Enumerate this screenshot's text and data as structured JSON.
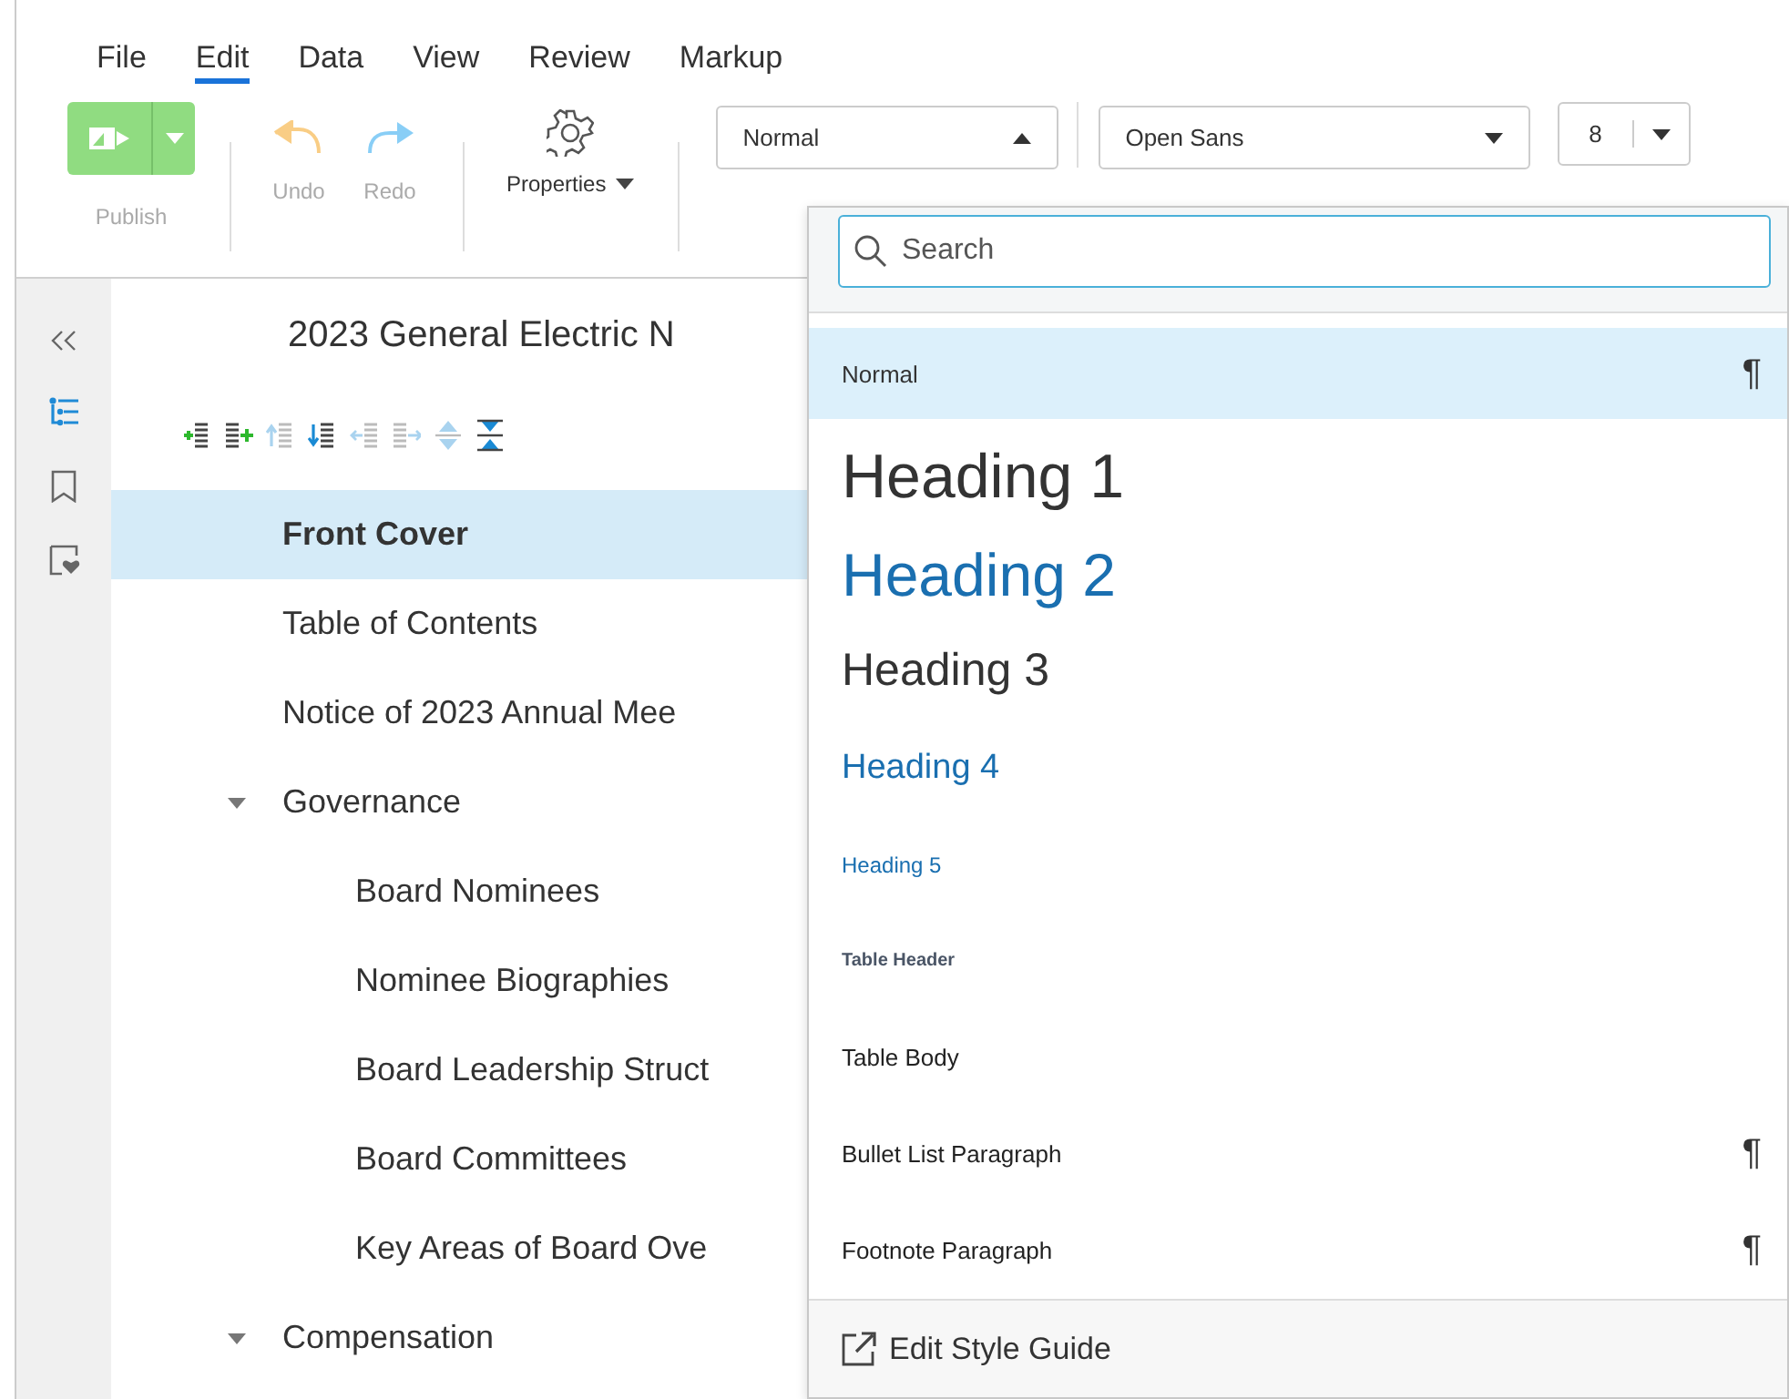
{
  "menu": [
    {
      "label": "File",
      "selected": false
    },
    {
      "label": "Edit",
      "selected": true
    },
    {
      "label": "Data",
      "selected": false
    },
    {
      "label": "View",
      "selected": false
    },
    {
      "label": "Review",
      "selected": false
    },
    {
      "label": "Markup",
      "selected": false
    }
  ],
  "toolbar": {
    "publish": {
      "label": "Publish",
      "disabled": true
    },
    "undo": {
      "label": "Undo",
      "disabled": true
    },
    "redo": {
      "label": "Redo",
      "disabled": true
    },
    "properties": {
      "label": "Properties"
    },
    "style_select": {
      "value": "Normal",
      "expanded": true
    },
    "font_select": {
      "value": "Open Sans",
      "expanded": false
    },
    "size_select": {
      "value": "8",
      "expanded": false
    }
  },
  "rail": [
    {
      "kind": "collapse",
      "selected": false
    },
    {
      "kind": "outline",
      "selected": true
    },
    {
      "kind": "bookmark",
      "selected": false
    },
    {
      "kind": "comment",
      "selected": false
    }
  ],
  "outline": {
    "title": "2023 General Electric N",
    "tools": [
      {
        "kind": "add-before",
        "disabled": false
      },
      {
        "kind": "add-after",
        "disabled": false
      },
      {
        "kind": "move-up",
        "disabled": true
      },
      {
        "kind": "move-down",
        "disabled": false
      },
      {
        "kind": "outdent",
        "disabled": true
      },
      {
        "kind": "indent",
        "disabled": true
      },
      {
        "kind": "expand-all",
        "disabled": true
      },
      {
        "kind": "collapse-all",
        "disabled": false
      }
    ],
    "items": [
      {
        "label": "Front Cover",
        "selected": true
      },
      {
        "label": "Table of Contents",
        "selected": false
      },
      {
        "label": "Notice of 2023 Annual Mee",
        "selected": false
      },
      {
        "label": "Governance",
        "selected": false,
        "expanded": true,
        "children": [
          {
            "label": "Board Nominees",
            "selected": false
          },
          {
            "label": "Nominee Biographies",
            "selected": false
          },
          {
            "label": "Board Leadership Struct",
            "selected": false
          },
          {
            "label": "Board Committees",
            "selected": false
          },
          {
            "label": "Key Areas of Board Ove",
            "selected": false
          }
        ]
      },
      {
        "label": "Compensation",
        "selected": false,
        "expanded": true
      }
    ]
  },
  "style_menu": {
    "search": {
      "placeholder": "Search"
    },
    "styles": [
      {
        "label": "Normal",
        "kind": "normal",
        "selected": true,
        "mark": "¶"
      },
      {
        "label": "Heading 1",
        "kind": "heading1",
        "selected": false
      },
      {
        "label": "Heading 2",
        "kind": "heading2",
        "selected": false
      },
      {
        "label": "Heading 3",
        "kind": "heading3",
        "selected": false
      },
      {
        "label": "Heading 4",
        "kind": "heading4",
        "selected": false
      },
      {
        "label": "Heading 5",
        "kind": "heading5",
        "selected": false
      },
      {
        "label": "Table Header",
        "kind": "table-header",
        "selected": false
      },
      {
        "label": "Table Body",
        "kind": "paragraph",
        "selected": false
      },
      {
        "label": "Bullet List Paragraph",
        "kind": "paragraph",
        "selected": false,
        "mark": "¶"
      },
      {
        "label": "Footnote Paragraph",
        "kind": "paragraph",
        "selected": false,
        "mark": "¶"
      }
    ],
    "footer": {
      "label": "Edit Style Guide"
    }
  }
}
